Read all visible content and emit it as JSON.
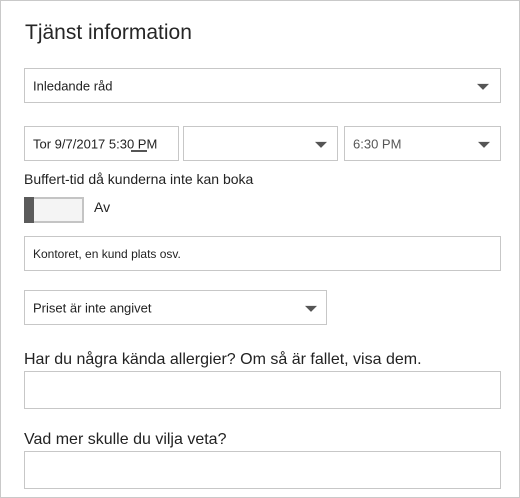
{
  "panel": {
    "title": "Tjänst information"
  },
  "service_select": {
    "value": "Inledande råd"
  },
  "schedule": {
    "start_datetime": "Tor 9/7/2017 5:30 PM",
    "end_date": "",
    "end_time": "6:30 PM"
  },
  "buffer": {
    "label": "Buffert-tid då kunderna inte kan boka",
    "toggle_state": "Av"
  },
  "location": {
    "placeholder": "Kontoret, en kund plats osv."
  },
  "price": {
    "value": "Priset är inte angivet"
  },
  "allergies": {
    "question": "Har du några kända allergier? Om så är fallet, visa dem.",
    "answer": ""
  },
  "more_info": {
    "question": "Vad mer skulle du vilja veta?",
    "answer": ""
  }
}
